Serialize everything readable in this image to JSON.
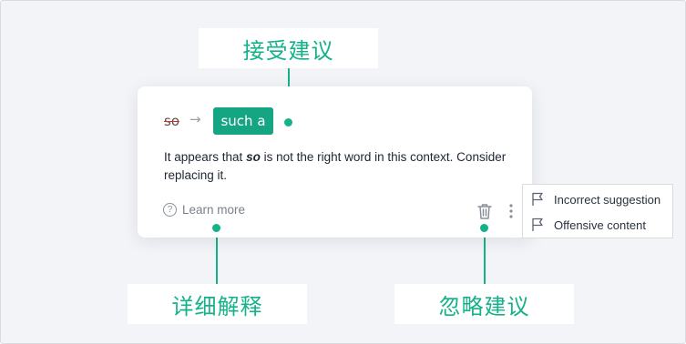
{
  "callouts": {
    "accept": "接受建议",
    "detail": "详细解释",
    "ignore": "忽略建议"
  },
  "card": {
    "original_word": "so",
    "arrow": "→",
    "suggestion": "such a",
    "message_before": "It appears that ",
    "message_keyword": "so",
    "message_after": " is not the right word in this context. Consider replacing it.",
    "learn_more": "Learn more",
    "help_glyph": "?",
    "icons": [
      "help-circle-icon",
      "trash-icon",
      "more-vertical-icon"
    ]
  },
  "menu": {
    "items": [
      {
        "label": "Incorrect suggestion",
        "icon": "flag-icon"
      },
      {
        "label": "Offensive content",
        "icon": "flag-icon"
      }
    ]
  },
  "colors": {
    "accent": "#15a582",
    "callout_text": "#15b28a",
    "background": "#f2f4f7"
  }
}
